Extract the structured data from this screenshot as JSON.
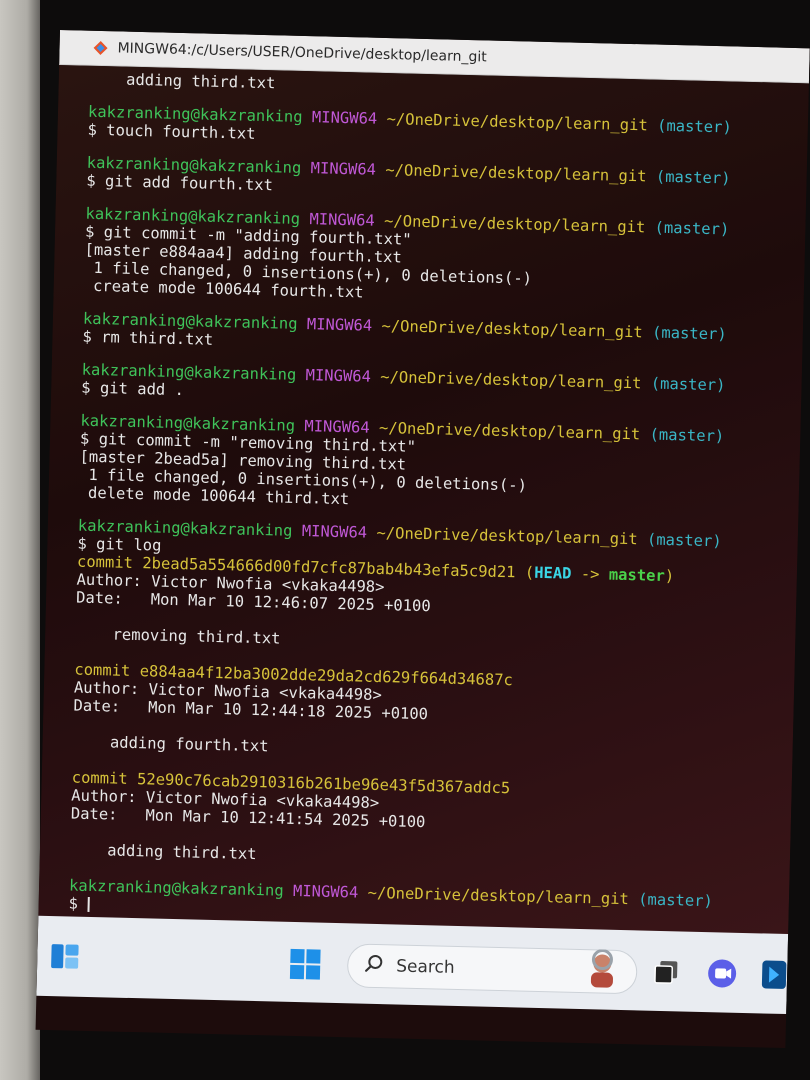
{
  "window": {
    "title": "MINGW64:/c/Users/USER/OneDrive/desktop/learn_git"
  },
  "prompt": {
    "user": "kakzranking@kakzranking",
    "system": "MINGW64",
    "path": "~/OneDrive/desktop/learn_git",
    "branch": "(master)",
    "symbol": "$"
  },
  "terminal": {
    "top_line": "    adding third.txt",
    "blocks": [
      {
        "command": "touch fourth.txt",
        "output": []
      },
      {
        "command": "git add fourth.txt",
        "output": []
      },
      {
        "command": "git commit -m \"adding fourth.txt\"",
        "output": [
          "[master e884aa4] adding fourth.txt",
          " 1 file changed, 0 insertions(+), 0 deletions(-)",
          " create mode 100644 fourth.txt"
        ]
      },
      {
        "command": "rm third.txt",
        "output": []
      },
      {
        "command": "git add .",
        "output": []
      },
      {
        "command": "git commit -m \"removing third.txt\"",
        "output": [
          "[master 2bead5a] removing third.txt",
          " 1 file changed, 0 insertions(+), 0 deletions(-)",
          " delete mode 100644 third.txt"
        ]
      },
      {
        "command": "git log",
        "output": []
      }
    ],
    "log": [
      {
        "commit_label": "commit",
        "hash": "2bead5a554666d00fd7cfc87bab4b43efa5c9d21",
        "ref_open": "(",
        "ref_head": "HEAD",
        "ref_arrow": " -> ",
        "ref_branch": "master",
        "ref_close": ")",
        "author": "Author: Victor Nwofia <vkaka4498>",
        "date": "Date:   Mon Mar 10 12:46:07 2025 +0100",
        "message": "    removing third.txt"
      },
      {
        "commit_label": "commit",
        "hash": "e884aa4f12ba3002dde29da2cd629f664d34687c",
        "author": "Author: Victor Nwofia <vkaka4498>",
        "date": "Date:   Mon Mar 10 12:44:18 2025 +0100",
        "message": "    adding fourth.txt"
      },
      {
        "commit_label": "commit",
        "hash": "52e90c76cab2910316b261be96e43f5d367addc5",
        "author": "Author: Victor Nwofia <vkaka4498>",
        "date": "Date:   Mon Mar 10 12:41:54 2025 +0100",
        "message": "    adding third.txt"
      }
    ]
  },
  "taskbar": {
    "search_label": "Search",
    "icons": [
      "widgets-icon",
      "start-icon",
      "search-icon",
      "avatar",
      "task-view-icon",
      "chat-icon",
      "app-icon"
    ]
  },
  "colors": {
    "user": "#3fc35a",
    "system": "#c058d6",
    "path": "#d6c23a",
    "branch": "#3ab6c6"
  }
}
